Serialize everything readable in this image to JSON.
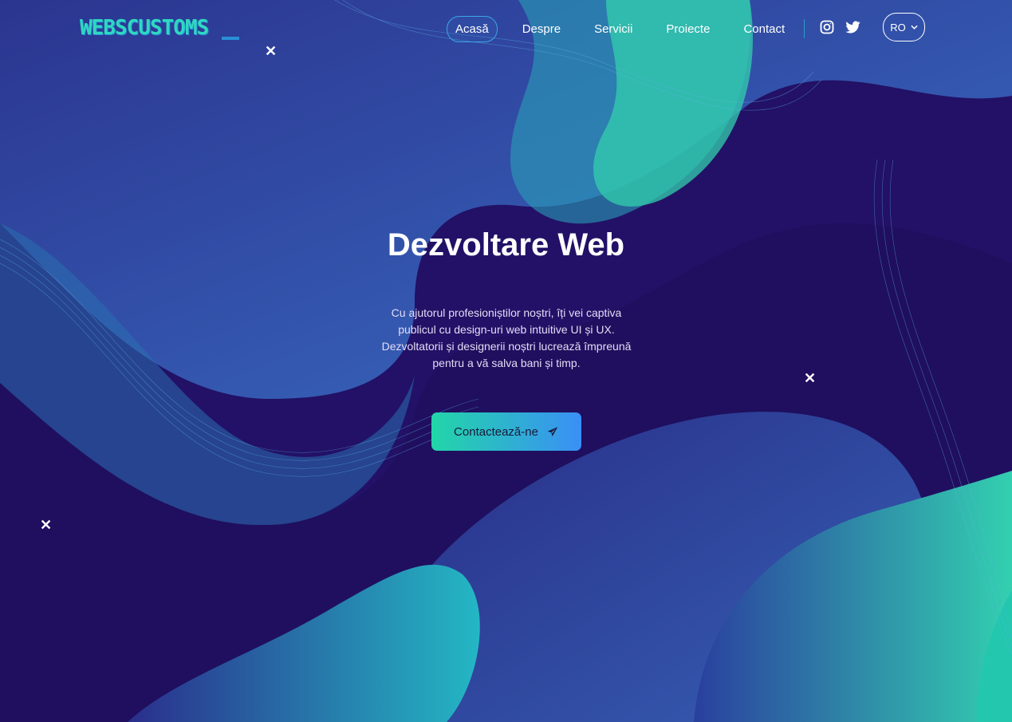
{
  "brand": {
    "logo_text": "WEBSCUSTOMS"
  },
  "nav": {
    "items": [
      {
        "label": "Acasă",
        "active": true
      },
      {
        "label": "Despre",
        "active": false
      },
      {
        "label": "Servicii",
        "active": false
      },
      {
        "label": "Proiecte",
        "active": false
      },
      {
        "label": "Contact",
        "active": false
      }
    ],
    "social": [
      "instagram-icon",
      "twitter-icon"
    ],
    "language": "RO"
  },
  "hero": {
    "title": "Dezvoltare Web",
    "description": "Cu ajutorul profesioniștilor noștri, îți vei captiva publicul cu design-uri web intuitive UI și UX. Dezvoltatorii și designerii noștri lucrează împreună pentru a vă salva bani și timp.",
    "cta_label": "Contactează-ne",
    "cta_icon": "paper-plane-icon"
  },
  "decor": {
    "close_glyph": "✕"
  },
  "colors": {
    "background": "#221166",
    "teal": "#2fd8c0",
    "blue": "#3a8ff6",
    "nav_active_border": "#3aa7e8"
  }
}
